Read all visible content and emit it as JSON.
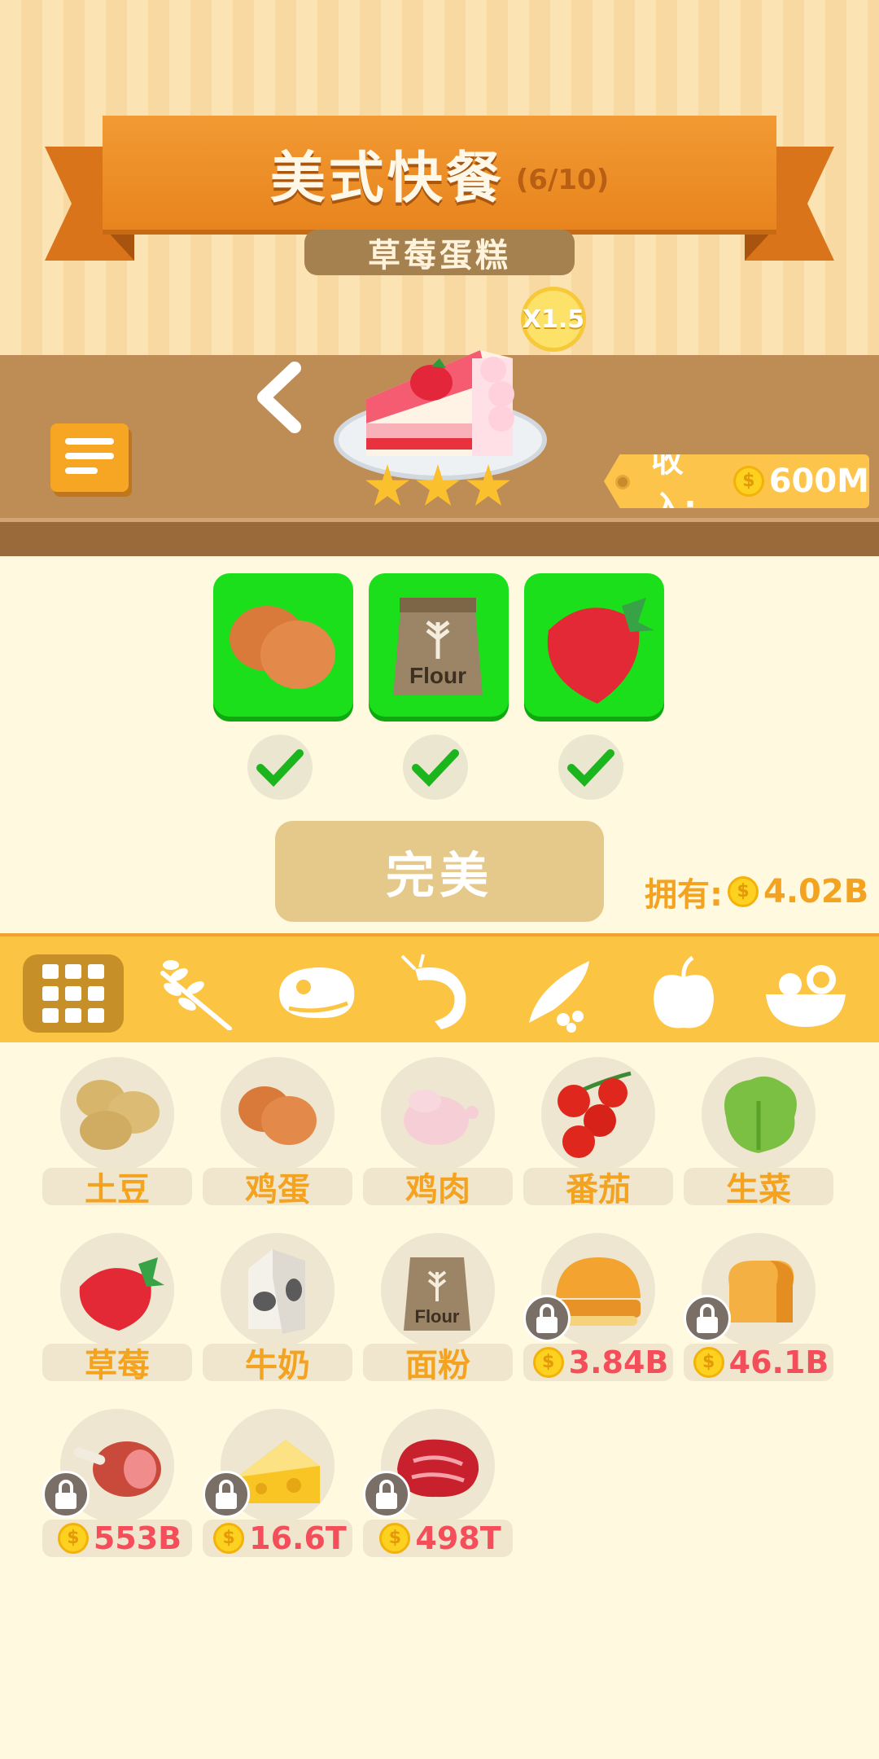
{
  "header": {
    "title": "美式快餐",
    "progress": "(6/10)",
    "dish_name": "草莓蛋糕",
    "multiplier": "X1.5",
    "stars": 3
  },
  "income": {
    "label": "收入:",
    "value": "600M"
  },
  "recipe": {
    "ingredients": [
      "egg-icon",
      "flour-icon",
      "strawberry-icon"
    ],
    "checks": [
      true,
      true,
      true
    ],
    "button_label": "完美"
  },
  "owned": {
    "label": "拥有:",
    "value": "4.02B"
  },
  "categories": [
    "all-grid-icon",
    "grain-icon",
    "meat-icon",
    "shrimp-icon",
    "pea-icon",
    "apple-icon",
    "salad-icon"
  ],
  "items": [
    {
      "name": "土豆",
      "icon": "potato-icon",
      "locked": false
    },
    {
      "name": "鸡蛋",
      "icon": "egg-icon",
      "locked": false
    },
    {
      "name": "鸡肉",
      "icon": "chicken-icon",
      "locked": false
    },
    {
      "name": "番茄",
      "icon": "tomato-icon",
      "locked": false
    },
    {
      "name": "生菜",
      "icon": "lettuce-icon",
      "locked": false
    },
    {
      "name": "草莓",
      "icon": "strawberry-icon",
      "locked": false
    },
    {
      "name": "牛奶",
      "icon": "milk-icon",
      "locked": false
    },
    {
      "name": "面粉",
      "icon": "flour-icon",
      "locked": false
    },
    {
      "price": "3.84B",
      "icon": "bun-icon",
      "locked": true
    },
    {
      "price": "46.1B",
      "icon": "bread-icon",
      "locked": true
    },
    {
      "price": "553B",
      "icon": "ham-icon",
      "locked": true
    },
    {
      "price": "16.6T",
      "icon": "cheese-icon",
      "locked": true
    },
    {
      "price": "498T",
      "icon": "steak-icon",
      "locked": true
    }
  ],
  "coin_symbol": "$",
  "flour_text": "Flour"
}
